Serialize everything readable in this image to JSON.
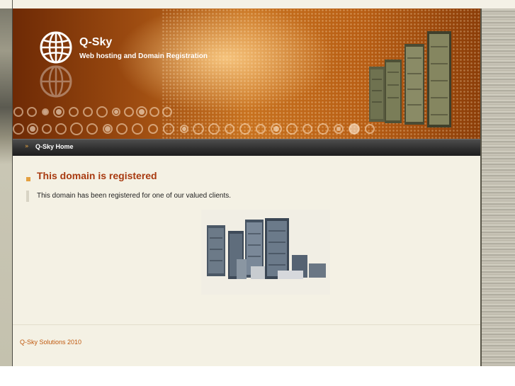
{
  "header": {
    "site_title": "Q-Sky",
    "tagline": "Web hosting and Domain Registration"
  },
  "nav": {
    "arrow": "»",
    "home_label": "Q-Sky Home"
  },
  "main": {
    "title": "This domain is registered",
    "body": "This domain has been registered for one of our valued clients."
  },
  "footer": {
    "text": "Q-Sky Solutions 2010"
  },
  "colors": {
    "banner_orange": "#c8721f",
    "title_red": "#a83a10",
    "footer_orange": "#c05a10",
    "content_bg": "#f4f1e4",
    "nav_dark": "#2f2f2f"
  },
  "icons": {
    "logo": "globe-icon",
    "nav_arrow": "double-chevron-right-icon"
  }
}
